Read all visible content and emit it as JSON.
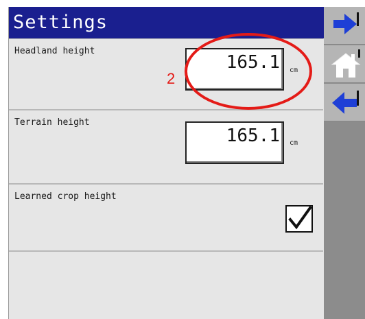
{
  "title": "Settings",
  "rows": [
    {
      "label": "Headland height",
      "value": "165.1",
      "unit": "cm"
    },
    {
      "label": "Terrain height",
      "value": "165.1",
      "unit": "cm"
    },
    {
      "label": "Learned crop height",
      "checked": true
    }
  ],
  "sidebar": {
    "buttons": [
      {
        "icon": "arrow-right-icon"
      },
      {
        "icon": "home-icon"
      },
      {
        "icon": "arrow-left-icon"
      }
    ]
  },
  "annotation": {
    "number": "2",
    "color": "#e41b17"
  },
  "colors": {
    "title_bar": "#1a1f8f",
    "accent_arrow": "#1e3fd6"
  }
}
